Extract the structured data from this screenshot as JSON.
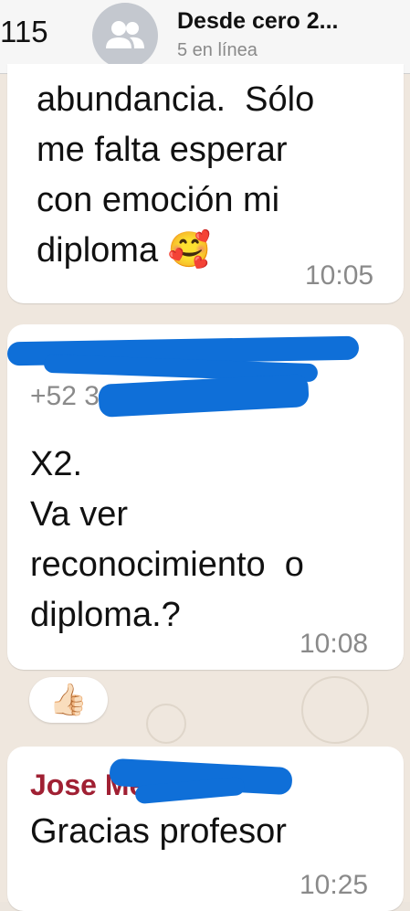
{
  "header": {
    "back_count": "115",
    "title": "Desde cero 2...",
    "subtitle": "5 en línea"
  },
  "messages": [
    {
      "text": "abundancia.  Sólo\nme falta esperar\ncon emoción mi\ndiploma 🥰",
      "time": "10:05"
    },
    {
      "sender_name": "+52",
      "sender_number": "+52                        33",
      "text": "X2.\nVa ver\nreconocimiento  o\ndiploma.?",
      "time": "10:08",
      "reaction": "👍🏻"
    },
    {
      "sender_name": "Jose                      Mec...",
      "text": "Gracias profesor",
      "time": "10:25"
    }
  ]
}
